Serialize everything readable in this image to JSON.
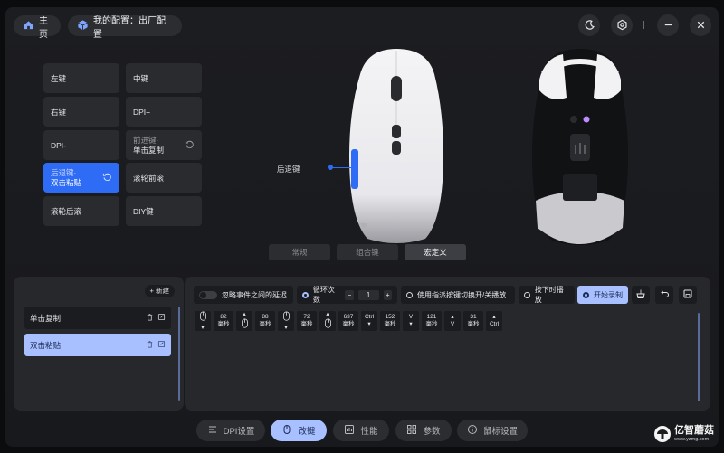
{
  "header": {
    "home_label": "主页",
    "config_label": "我的配置：出厂配置"
  },
  "keys": [
    {
      "label": "左键"
    },
    {
      "label": "中键"
    },
    {
      "label": "右键"
    },
    {
      "label": "DPI+"
    },
    {
      "label": "DPI-"
    },
    {
      "label": "前进键·",
      "sub": "单击复制"
    },
    {
      "label": "后退键·",
      "sub": "双击粘贴"
    },
    {
      "label": "滚轮前滚"
    },
    {
      "label": "滚轮后滚"
    },
    {
      "label": "DIY键"
    }
  ],
  "mouse_callout": "后退键",
  "modes": [
    "常规",
    "组合键",
    "宏定义"
  ],
  "macro_list": {
    "new_label": "+ 新建",
    "items": [
      "单击复制",
      "双击粘贴"
    ]
  },
  "toolbar": {
    "ignore_delay_label": "忽略事件之间的延迟",
    "loop_label": "循环次数",
    "loop_value": "1",
    "toggle_label": "使用指派按键切换开/关播放",
    "hold_label": "按下时播放",
    "record_label": "开始录制"
  },
  "events": [
    {
      "kind": "mouse",
      "dir": "down"
    },
    {
      "kind": "delay",
      "value": "82",
      "unit": "毫秒"
    },
    {
      "kind": "mouse",
      "dir": "up"
    },
    {
      "kind": "delay",
      "value": "88",
      "unit": "毫秒"
    },
    {
      "kind": "mouse",
      "dir": "down"
    },
    {
      "kind": "delay",
      "value": "72",
      "unit": "毫秒"
    },
    {
      "kind": "mouse",
      "dir": "up"
    },
    {
      "kind": "delay",
      "value": "637",
      "unit": "毫秒"
    },
    {
      "kind": "key",
      "dir": "down",
      "key": "Ctrl"
    },
    {
      "kind": "delay",
      "value": "152",
      "unit": "毫秒"
    },
    {
      "kind": "key",
      "dir": "down",
      "key": "V"
    },
    {
      "kind": "delay",
      "value": "121",
      "unit": "毫秒"
    },
    {
      "kind": "key",
      "dir": "up",
      "key": "V"
    },
    {
      "kind": "delay",
      "value": "31",
      "unit": "毫秒"
    },
    {
      "kind": "key",
      "dir": "up",
      "key": "Ctrl"
    }
  ],
  "bottom_tabs": [
    "DPI设置",
    "改键",
    "性能",
    "参数",
    "鼠标设置"
  ],
  "watermark": {
    "name": "亿智蘑菇",
    "url": "www.yzmg.com"
  },
  "colors": {
    "accent": "#2f6cf5",
    "selection": "#a8c0ff"
  }
}
